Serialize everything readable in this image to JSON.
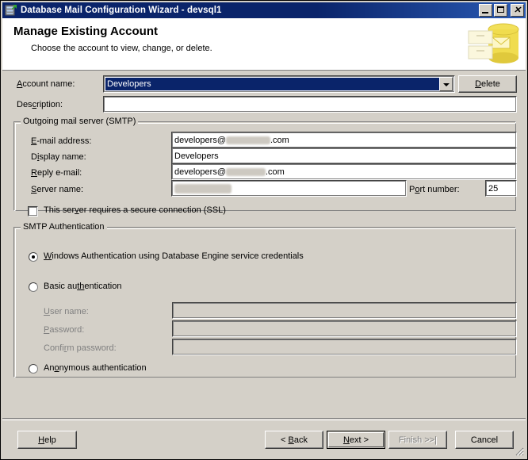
{
  "window": {
    "title": "Database Mail Configuration Wizard - devsql1",
    "icon": "database-mail-icon",
    "controls": {
      "minimize": "minimize-icon",
      "maximize": "maximize-icon",
      "close": "close-icon"
    }
  },
  "banner": {
    "heading": "Manage Existing Account",
    "subheading": "Choose the account to view, change, or delete.",
    "art": "database-mail-banner-icon"
  },
  "account": {
    "name_label": "Account name:",
    "name_label_accel": "A",
    "name_value": "Developers",
    "delete_label": "Delete",
    "delete_accel": "D",
    "description_label": "Description:",
    "description_accel": "c",
    "description_value": ""
  },
  "smtp": {
    "group_label": "Outgoing mail server (SMTP)",
    "email_label": "E-mail address:",
    "email_value_prefix": "developers@",
    "email_value_suffix": ".com",
    "email_value_redacted": true,
    "display_label": "Display name:",
    "display_value": "Developers",
    "reply_label": "Reply e-mail:",
    "reply_value_prefix": "developers@",
    "reply_value_suffix": ".com",
    "reply_value_redacted": true,
    "server_label": "Server name:",
    "server_value": "",
    "server_value_redacted": true,
    "port_label": "Port number:",
    "port_value": "25",
    "ssl_label": "This server requires a secure connection (SSL)",
    "ssl_checked": false
  },
  "auth": {
    "group_label": "SMTP Authentication",
    "windows_label": "Windows Authentication using Database Engine service credentials",
    "windows_selected": true,
    "basic_label": "Basic authentication",
    "basic_selected": false,
    "username_label": "User name:",
    "username_value": "",
    "password_label": "Password:",
    "password_value": "",
    "confirm_label": "Confirm password:",
    "confirm_value": "",
    "anonymous_label": "Anonymous authentication",
    "anonymous_selected": false
  },
  "footer": {
    "help": "Help",
    "back": "< Back",
    "next": "Next >",
    "finish": "Finish >>|",
    "cancel": "Cancel",
    "finish_enabled": false,
    "next_is_default": true
  },
  "colors": {
    "dialog_face": "#d4d0c8",
    "title_bar": "#0a246a",
    "selection": "#0a246a",
    "field_bg": "#ffffff",
    "disabled_text": "#808080"
  }
}
